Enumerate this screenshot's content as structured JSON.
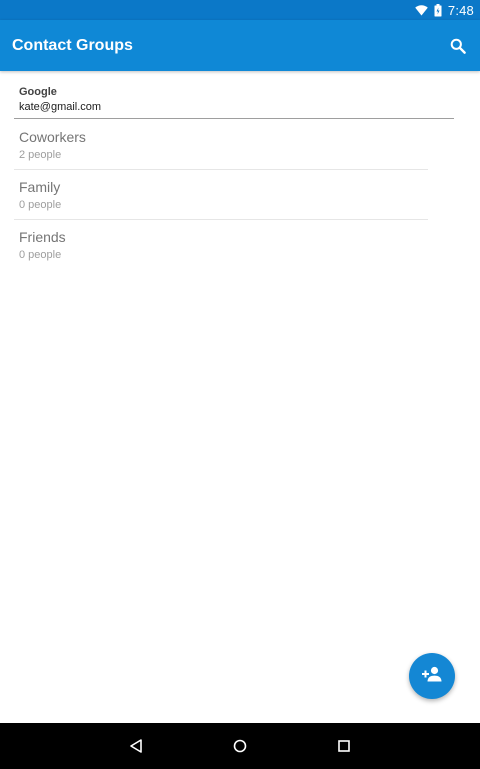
{
  "status_bar": {
    "time": "7:48",
    "icons": [
      "wifi-icon",
      "battery-icon"
    ]
  },
  "app_bar": {
    "title": "Contact Groups",
    "actions": [
      "search-icon"
    ]
  },
  "account": {
    "type": "Google",
    "email": "kate@gmail.com"
  },
  "groups": [
    {
      "name": "Coworkers",
      "count": "2 people"
    },
    {
      "name": "Family",
      "count": "0 people"
    },
    {
      "name": "Friends",
      "count": "0 people"
    }
  ],
  "fab": {
    "icon": "add-person-icon"
  },
  "nav_bar": {
    "icons": [
      "back-icon",
      "home-icon",
      "recents-icon"
    ]
  },
  "colors": {
    "status_bar": "#0b78c8",
    "app_bar": "#0f88d6",
    "fab": "#1487d4"
  }
}
